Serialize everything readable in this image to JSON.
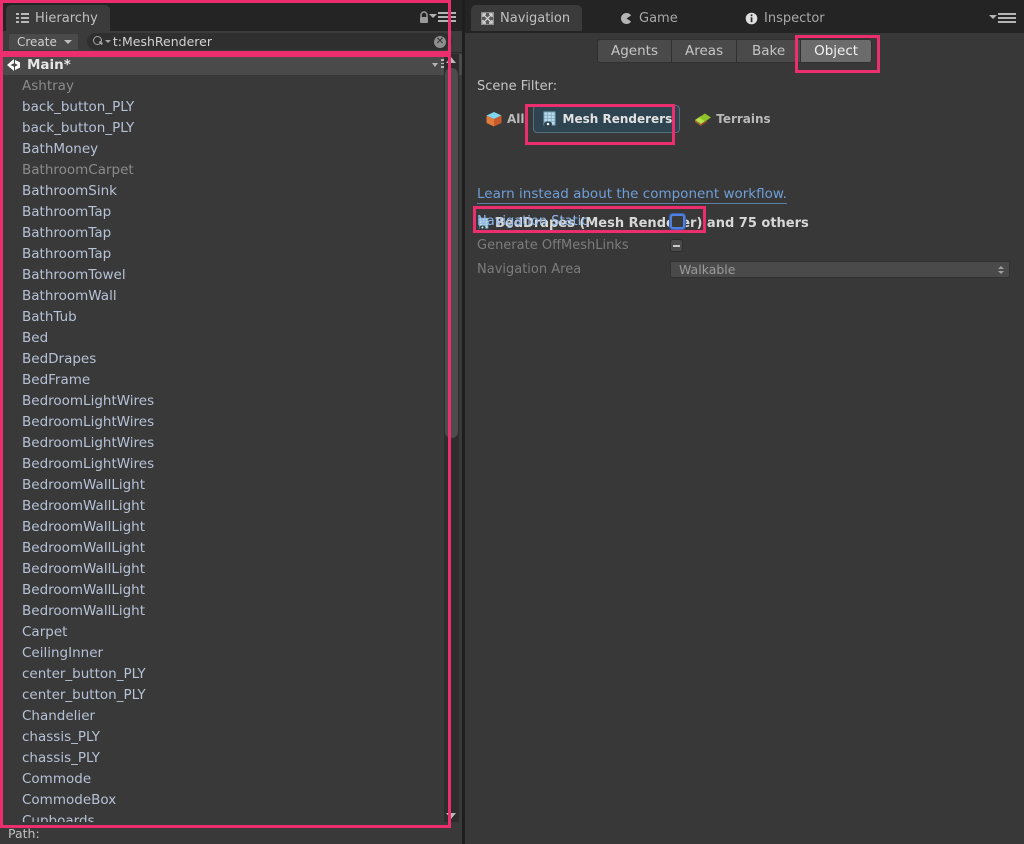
{
  "colors": {
    "highlight_pink": "#ec2d6e",
    "panel_bg": "#383838",
    "tab_bg": "#242424",
    "link_blue": "#6f9fd8",
    "selected_tab": "#6b6b6b"
  },
  "hierarchy": {
    "tab_label": "Hierarchy",
    "tab_icon": "hierarchy-list-icon",
    "lock_icon": "lock-icon",
    "menu_icon": "hamburger-menu-icon",
    "toolbar": {
      "create_label": "Create",
      "search_icon": "search-icon",
      "search_value": "t:MeshRenderer",
      "search_placeholder": "",
      "clear_icon": "clear-circle-icon",
      "clear_glyph": "✕"
    },
    "root": {
      "label": "Main*",
      "icon": "unity-scene-icon",
      "menu_icon": "scene-options-icon"
    },
    "items": [
      {
        "label": "Ashtray",
        "dim": true
      },
      {
        "label": "back_button_PLY",
        "dim": false
      },
      {
        "label": "back_button_PLY",
        "dim": false
      },
      {
        "label": "BathMoney",
        "dim": false
      },
      {
        "label": "BathroomCarpet",
        "dim": true
      },
      {
        "label": "BathroomSink",
        "dim": false
      },
      {
        "label": "BathroomTap",
        "dim": false
      },
      {
        "label": "BathroomTap",
        "dim": false
      },
      {
        "label": "BathroomTap",
        "dim": false
      },
      {
        "label": "BathroomTowel",
        "dim": false
      },
      {
        "label": "BathroomWall",
        "dim": false
      },
      {
        "label": "BathTub",
        "dim": false
      },
      {
        "label": "Bed",
        "dim": false
      },
      {
        "label": "BedDrapes",
        "dim": false
      },
      {
        "label": "BedFrame",
        "dim": false
      },
      {
        "label": "BedroomLightWires",
        "dim": false
      },
      {
        "label": "BedroomLightWires",
        "dim": false
      },
      {
        "label": "BedroomLightWires",
        "dim": false
      },
      {
        "label": "BedroomLightWires",
        "dim": false
      },
      {
        "label": "BedroomWallLight",
        "dim": false
      },
      {
        "label": "BedroomWallLight",
        "dim": false
      },
      {
        "label": "BedroomWallLight",
        "dim": false
      },
      {
        "label": "BedroomWallLight",
        "dim": false
      },
      {
        "label": "BedroomWallLight",
        "dim": false
      },
      {
        "label": "BedroomWallLight",
        "dim": false
      },
      {
        "label": "BedroomWallLight",
        "dim": false
      },
      {
        "label": "Carpet",
        "dim": false
      },
      {
        "label": "CeilingInner",
        "dim": false
      },
      {
        "label": "center_button_PLY",
        "dim": false
      },
      {
        "label": "center_button_PLY",
        "dim": false
      },
      {
        "label": "Chandelier",
        "dim": false
      },
      {
        "label": "chassis_PLY",
        "dim": false
      },
      {
        "label": "chassis_PLY",
        "dim": false
      },
      {
        "label": "Commode",
        "dim": false
      },
      {
        "label": "CommodeBox",
        "dim": false
      },
      {
        "label": "Cupboards",
        "dim": false
      }
    ],
    "footer_label": "Path:",
    "scrollbar": {
      "up_arrow_icon": "scroll-up-arrow-icon",
      "down_arrow_icon": "scroll-down-arrow-icon"
    }
  },
  "right_panel": {
    "tabs": [
      {
        "label": "Navigation",
        "icon": "navigation-icon",
        "active": true
      },
      {
        "label": "Game",
        "icon": "game-icon",
        "active": false
      },
      {
        "label": "Inspector",
        "icon": "info-icon",
        "active": false
      }
    ],
    "menu_icon": "hamburger-menu-icon",
    "nav_tabs": [
      {
        "label": "Agents",
        "selected": false
      },
      {
        "label": "Areas",
        "selected": false
      },
      {
        "label": "Bake",
        "selected": false
      },
      {
        "label": "Object",
        "selected": true
      }
    ],
    "scene_filter": {
      "label": "Scene Filter:",
      "options": [
        {
          "label": "All",
          "icon": "cube-icon",
          "selected": false
        },
        {
          "label": "Mesh Renderers",
          "icon": "mesh-renderer-icon",
          "selected": true
        },
        {
          "label": "Terrains",
          "icon": "terrain-icon",
          "selected": false
        }
      ]
    },
    "component_link": "Learn instead about the component workflow.",
    "selection_summary": {
      "icon": "mesh-renderer-icon",
      "text": "BedDrapes (Mesh Renderer) and 75 others"
    },
    "properties": [
      {
        "name": "Navigation Static",
        "control": "checkbox",
        "state": "focused-unchecked",
        "enabled": true,
        "highlighted": true
      },
      {
        "name": "Generate OffMeshLinks",
        "control": "checkbox",
        "state": "mixed",
        "enabled": false,
        "highlighted": false
      },
      {
        "name": "Navigation Area",
        "control": "popup",
        "value": "Walkable",
        "enabled": false,
        "highlighted": false
      }
    ]
  },
  "annotations": [
    {
      "name": "hierarchy-panel-highlight"
    },
    {
      "name": "object-tab-highlight"
    },
    {
      "name": "mesh-renderers-filter-highlight"
    },
    {
      "name": "navigation-static-highlight"
    }
  ]
}
